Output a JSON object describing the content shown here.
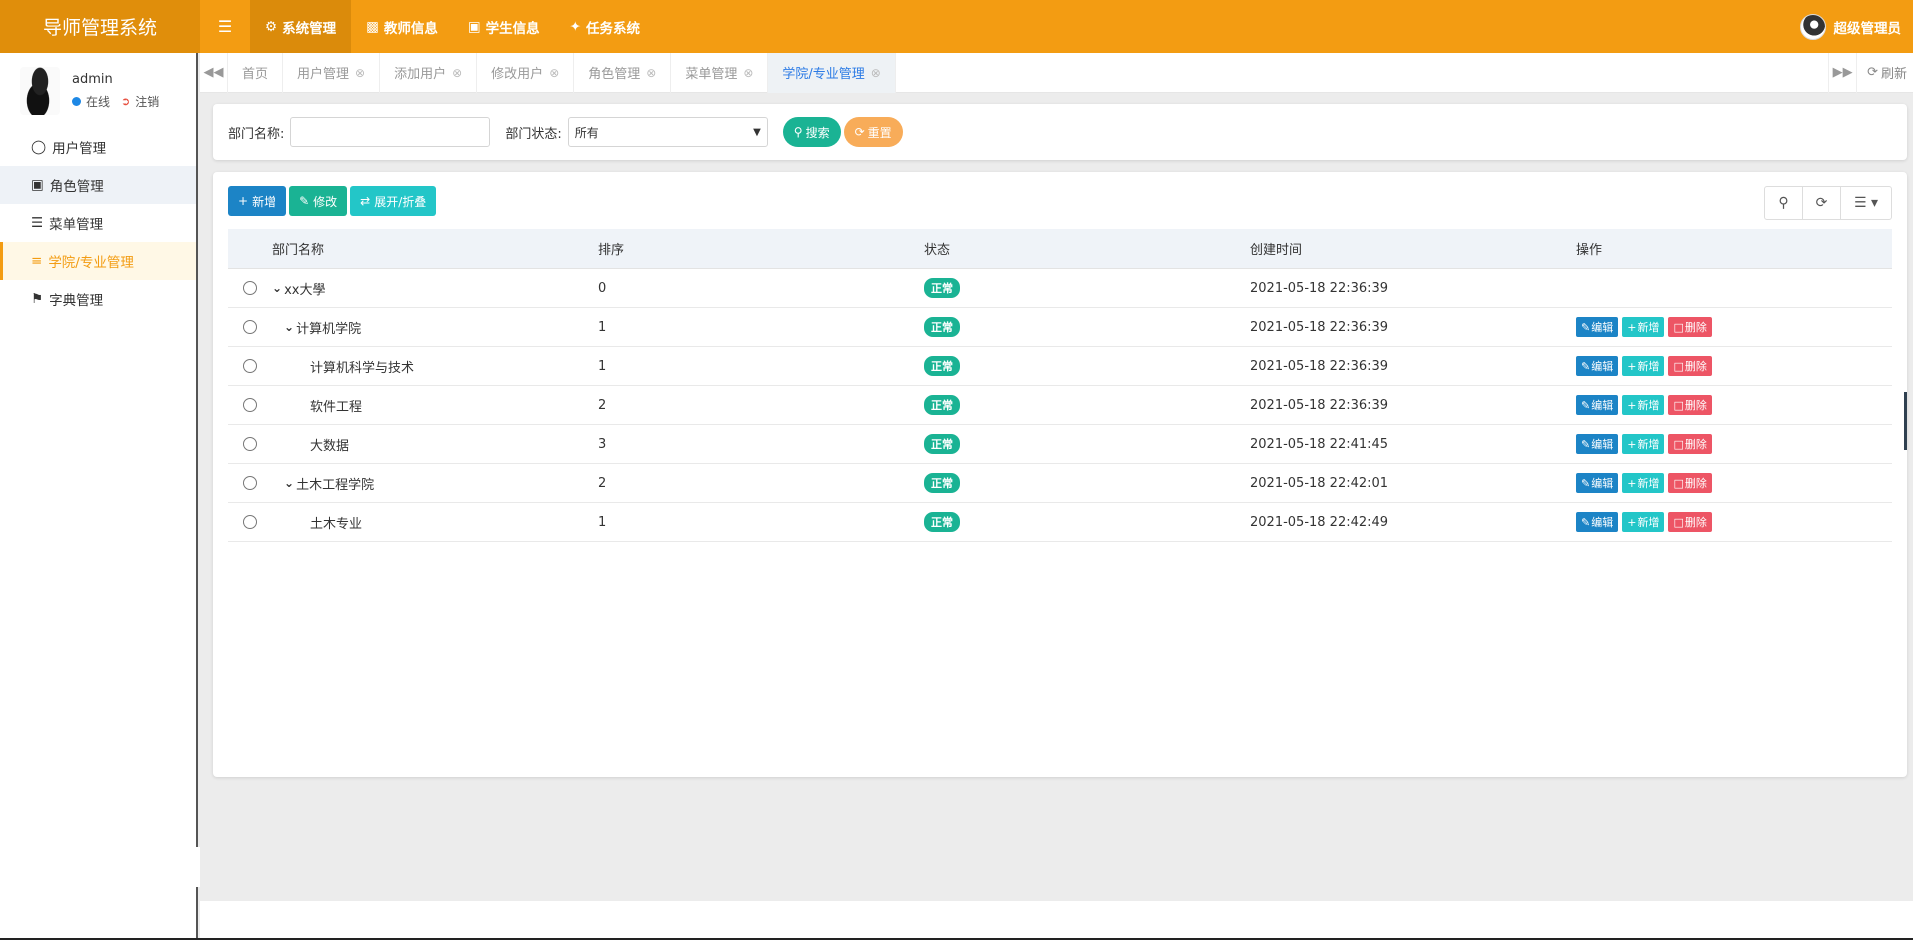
{
  "app": {
    "title": "导师管理系统"
  },
  "topnav": {
    "menu_icon": "hamburger-icon",
    "items": [
      {
        "label": "系统管理",
        "icon": "gear-icon",
        "active": true
      },
      {
        "label": "教师信息",
        "icon": "contact-book-icon"
      },
      {
        "label": "学生信息",
        "icon": "id-card-icon"
      },
      {
        "label": "任务系统",
        "icon": "tint-icon"
      }
    ],
    "user": "超级管理员"
  },
  "sidebar": {
    "username": "admin",
    "status": "在线",
    "logout": "注销",
    "items": [
      {
        "label": "用户管理",
        "icon": "user-icon"
      },
      {
        "label": "角色管理",
        "icon": "lock-icon"
      },
      {
        "label": "菜单管理",
        "icon": "list-icon"
      },
      {
        "label": "学院/专业管理",
        "icon": "outdent-icon",
        "active": true
      },
      {
        "label": "字典管理",
        "icon": "bookmark-icon"
      }
    ]
  },
  "tabs": {
    "items": [
      {
        "label": "首页",
        "closable": false
      },
      {
        "label": "用户管理",
        "closable": true
      },
      {
        "label": "添加用户",
        "closable": true
      },
      {
        "label": "修改用户",
        "closable": true
      },
      {
        "label": "角色管理",
        "closable": true
      },
      {
        "label": "菜单管理",
        "closable": true
      },
      {
        "label": "学院/专业管理",
        "closable": true,
        "active": true
      }
    ],
    "refresh_label": "刷新"
  },
  "search": {
    "dept_name_label": "部门名称:",
    "dept_name_value": "",
    "dept_status_label": "部门状态:",
    "dept_status_value": "所有",
    "search_label": "搜索",
    "reset_label": "重置"
  },
  "toolbar": {
    "add_label": "新增",
    "edit_label": "修改",
    "toggle_label": "展开/折叠"
  },
  "table": {
    "headers": [
      "部门名称",
      "排序",
      "状态",
      "创建时间",
      "操作"
    ],
    "rows": [
      {
        "name": "xx大學",
        "level": 0,
        "expanded": true,
        "sort": "0",
        "status": "正常",
        "time": "2021-05-18 22:36:39",
        "ops": false
      },
      {
        "name": "计算机学院",
        "level": 1,
        "expanded": true,
        "sort": "1",
        "status": "正常",
        "time": "2021-05-18 22:36:39",
        "ops": true
      },
      {
        "name": "计算机科学与技术",
        "level": 2,
        "sort": "1",
        "status": "正常",
        "time": "2021-05-18 22:36:39",
        "ops": true
      },
      {
        "name": "软件工程",
        "level": 2,
        "sort": "2",
        "status": "正常",
        "time": "2021-05-18 22:36:39",
        "ops": true
      },
      {
        "name": "大数据",
        "level": 2,
        "sort": "3",
        "status": "正常",
        "time": "2021-05-18 22:41:45",
        "ops": true
      },
      {
        "name": "土木工程学院",
        "level": 1,
        "expanded": true,
        "sort": "2",
        "status": "正常",
        "time": "2021-05-18 22:42:01",
        "ops": true
      },
      {
        "name": "土木专业",
        "level": 2,
        "sort": "1",
        "status": "正常",
        "time": "2021-05-18 22:42:49",
        "ops": true
      }
    ],
    "op_labels": {
      "edit": "编辑",
      "add": "新增",
      "delete": "删除"
    }
  },
  "colors": {
    "header": "#f39c12",
    "primary": "#1c84c6",
    "success": "#1ab394",
    "info": "#23c6c8",
    "danger": "#ed5565",
    "warning": "#f8ac59"
  }
}
